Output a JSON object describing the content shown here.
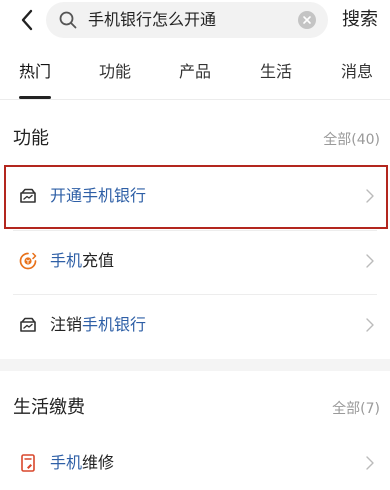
{
  "search": {
    "query": "手机银行怎么开通",
    "button_label": "搜索"
  },
  "tabs": [
    {
      "label": "热门",
      "active": true
    },
    {
      "label": "功能",
      "active": false
    },
    {
      "label": "产品",
      "active": false
    },
    {
      "label": "生活",
      "active": false
    },
    {
      "label": "消息",
      "active": false
    }
  ],
  "sections": [
    {
      "title": "功能",
      "all_label": "全部(40)",
      "items": [
        {
          "highlight": "开通手机银行",
          "rest": "",
          "icon": "wallet-icon",
          "selected": true
        },
        {
          "highlight": "手机",
          "rest": "充值",
          "icon": "coin-icon",
          "selected": false
        },
        {
          "prefix": "注销",
          "highlight": "手机银行",
          "rest": "",
          "icon": "wallet-icon",
          "selected": false
        }
      ]
    },
    {
      "title": "生活缴费",
      "all_label": "全部(7)",
      "items": [
        {
          "highlight": "手机",
          "rest": "维修",
          "icon": "phone-repair-icon",
          "selected": false
        }
      ]
    }
  ],
  "colors": {
    "highlight": "#2e5fa6",
    "focus_border": "#b3261e",
    "coin_icon": "#e8711a",
    "repair_icon": "#d9472b"
  }
}
